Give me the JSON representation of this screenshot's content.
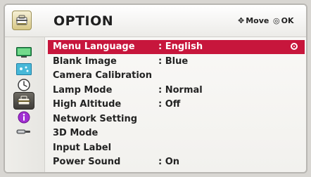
{
  "header": {
    "title": "OPTION",
    "icon": "toolbox-icon",
    "move_glyph": "✥",
    "move_label": "Move",
    "ok_glyph": "◎",
    "ok_label": "OK"
  },
  "sidebar": {
    "items": [
      {
        "name": "picture-icon",
        "selected": false
      },
      {
        "name": "screen-icon",
        "selected": false
      },
      {
        "name": "clock-icon",
        "selected": false
      },
      {
        "name": "option-icon",
        "selected": true
      },
      {
        "name": "info-icon",
        "selected": false
      },
      {
        "name": "input-icon",
        "selected": false
      }
    ]
  },
  "menu": {
    "items": [
      {
        "label": "Menu Language",
        "value": ": English",
        "active": true
      },
      {
        "label": "Blank Image",
        "value": ": Blue",
        "active": false
      },
      {
        "label": "Camera Calibration",
        "value": "",
        "active": false
      },
      {
        "label": "Lamp Mode",
        "value": ": Normal",
        "active": false
      },
      {
        "label": "High Altitude",
        "value": ": Off",
        "active": false
      },
      {
        "label": "Network Setting",
        "value": "",
        "active": false
      },
      {
        "label": "3D Mode",
        "value": "",
        "active": false
      },
      {
        "label": "Input Label",
        "value": "",
        "active": false
      },
      {
        "label": "Power Sound",
        "value": ": On",
        "active": false
      }
    ]
  },
  "colors": {
    "highlight": "#c7163c",
    "text": "#232323",
    "header_text": "#1f1f1f"
  }
}
